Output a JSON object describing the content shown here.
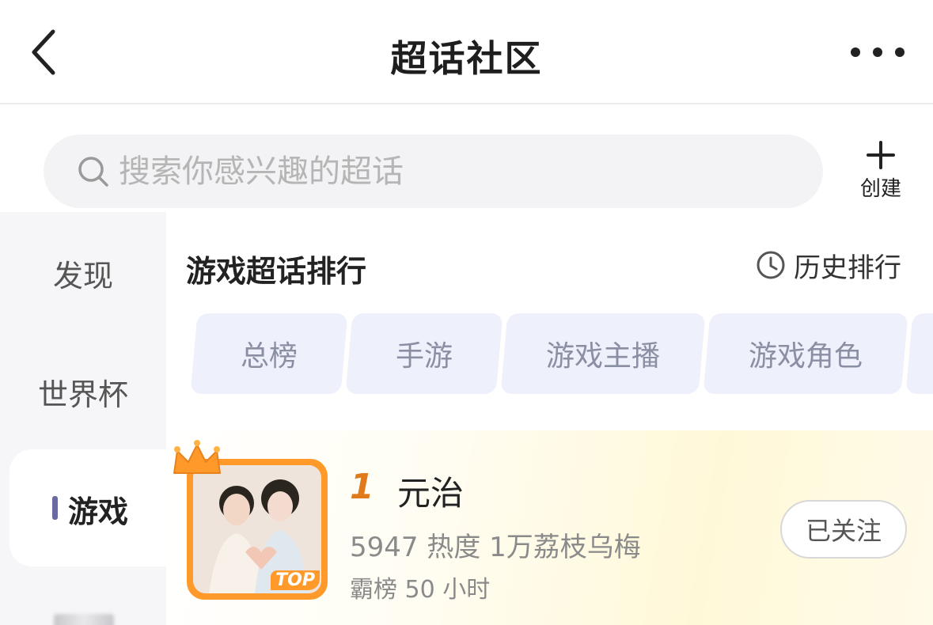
{
  "header": {
    "title": "超话社区",
    "back_icon": "chevron-left-icon",
    "more_icon": "more-horizontal-icon"
  },
  "search": {
    "placeholder": "搜索你感兴趣的超话",
    "icon": "search-icon"
  },
  "create": {
    "label": "创建",
    "icon": "plus-icon"
  },
  "sidebar": {
    "items": [
      {
        "label": "发现",
        "active": false
      },
      {
        "label": "世界杯",
        "active": false
      },
      {
        "label": "游戏",
        "active": true
      }
    ]
  },
  "section": {
    "title": "游戏超话排行",
    "history_label": "历史排行",
    "history_icon": "clock-icon"
  },
  "chips": [
    {
      "label": "总榜"
    },
    {
      "label": "手游"
    },
    {
      "label": "游戏主播"
    },
    {
      "label": "游戏角色"
    }
  ],
  "ranking": [
    {
      "rank": "1",
      "name": "元治",
      "stats": "5947 热度 1万荔枝乌梅",
      "streak": "霸榜 50 小时",
      "badge": "TOP",
      "follow_label": "已关注",
      "accent": "#ff9a2a"
    }
  ],
  "colors": {
    "chip_bg": "#eef0fb",
    "chip_text": "#8b8fa3",
    "active_bar": "#6a6aa0",
    "rank_orange": "#e07a1a"
  }
}
